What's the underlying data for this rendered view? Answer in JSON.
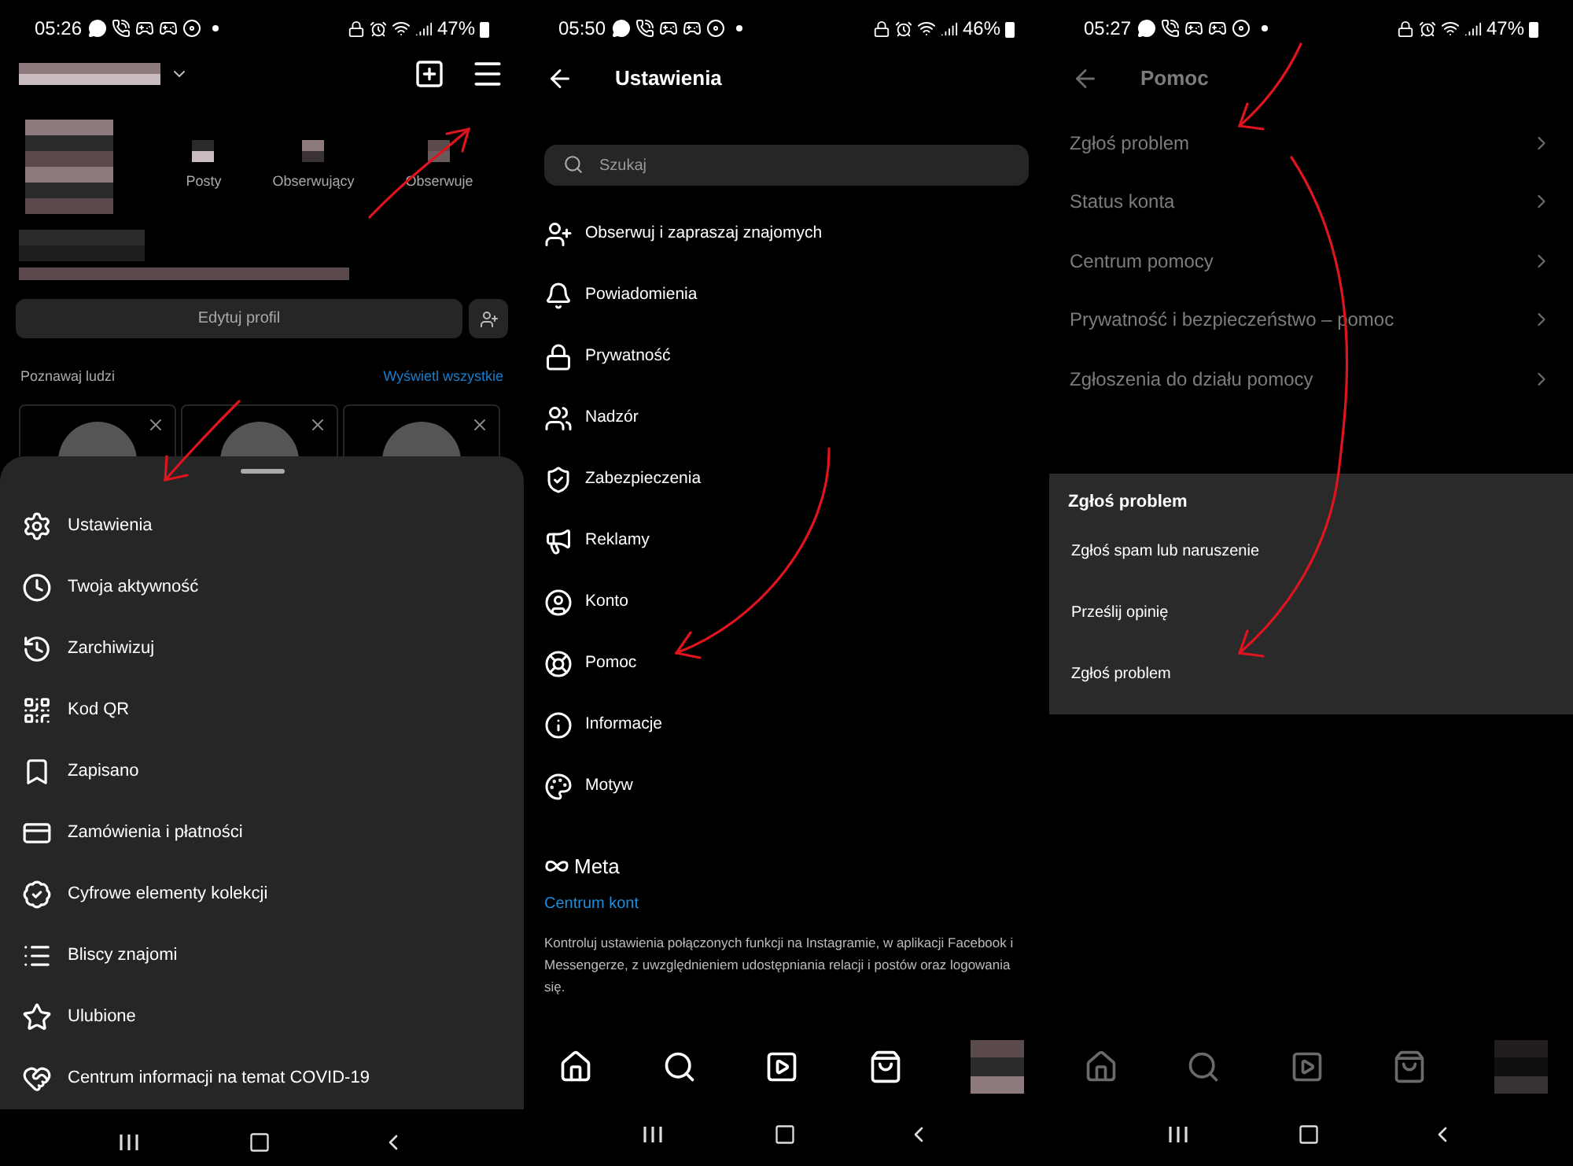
{
  "profile_screen": {
    "status_bar": {
      "time": "05:26",
      "battery": "47%"
    },
    "stats": [
      "Posty",
      "Obserwujący",
      "Obserwuje"
    ],
    "edit_button": "Edytuj profil",
    "suggestions": {
      "title": "Poznawaj ludzi",
      "see_all": "Wyświetl wszystkie"
    },
    "menu": [
      "Ustawienia",
      "Twoja aktywność",
      "Zarchiwizuj",
      "Kod QR",
      "Zapisano",
      "Zamówienia i płatności",
      "Cyfrowe elementy kolekcji",
      "Bliscy znajomi",
      "Ulubione",
      "Centrum informacji na temat COVID-19"
    ]
  },
  "settings_screen": {
    "status_bar": {
      "time": "05:50",
      "battery": "46%"
    },
    "title": "Ustawienia",
    "search": {
      "placeholder": "Szukaj"
    },
    "items": [
      "Obserwuj i zapraszaj znajomych",
      "Powiadomienia",
      "Prywatność",
      "Nadzór",
      "Zabezpieczenia",
      "Reklamy",
      "Konto",
      "Pomoc",
      "Informacje",
      "Motyw"
    ],
    "meta": {
      "logo": "Meta",
      "link": "Centrum kont",
      "description": "Kontroluj ustawienia połączonych funkcji na Instagramie, w aplikacji Facebook i Messengerze, z uwzględnieniem udostępniania relacji i postów oraz logowania się."
    }
  },
  "help_screen": {
    "status_bar": {
      "time": "05:27",
      "battery": "47%"
    },
    "dimmed": true,
    "title": "Pomoc",
    "items": [
      "Zgłoś problem",
      "Status konta",
      "Centrum pomocy",
      "Prywatność i bezpieczeństwo – pomoc",
      "Zgłoszenia do działu pomocy"
    ],
    "sheet": {
      "title": "Zgłoś problem",
      "options": [
        "Zgłoś spam lub naruszenie",
        "Prześlij opinię",
        "Zgłoś problem"
      ]
    }
  }
}
